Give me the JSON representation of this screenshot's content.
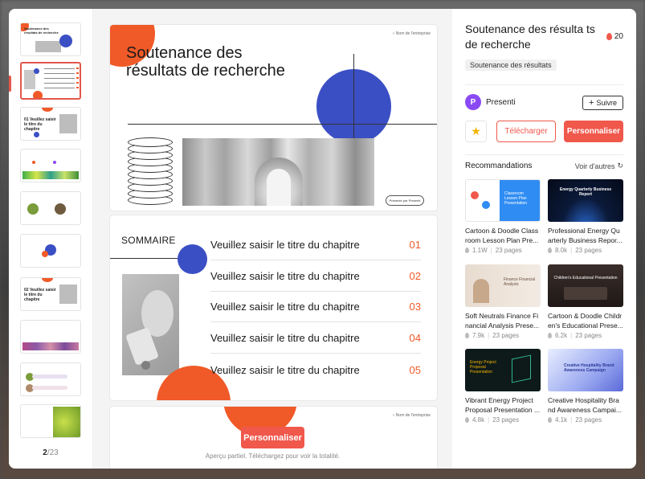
{
  "thumbnails": {
    "pager_current": "2",
    "pager_total": "/23",
    "first_title": "Soutenance des résultats de recherche",
    "third_title": "01 Veuillez saisir le titre du chapitre",
    "seventh_title": "02 Veuillez saisir le titre du chapitre"
  },
  "preview": {
    "company_label": "Nom de l'entreprise",
    "slide1_title_line1": "Soutenance des",
    "slide1_title_line2": "résultats de recherche",
    "presenter_label": "Présenté par Presenti",
    "sommaire": "SOMMAIRE",
    "toc": [
      {
        "text": "Veuillez saisir le titre du chapitre",
        "num": "01"
      },
      {
        "text": "Veuillez saisir le titre du chapitre",
        "num": "02"
      },
      {
        "text": "Veuillez saisir le titre du chapitre",
        "num": "03"
      },
      {
        "text": "Veuillez saisir le titre du chapitre",
        "num": "04"
      },
      {
        "text": "Veuillez saisir le titre du chapitre",
        "num": "05"
      }
    ],
    "cta_label": "Personnaliser",
    "note": "Aperçu partiel. Téléchargez pour voir la totalité."
  },
  "panel": {
    "title": "Soutenance des résulta ts de recherche",
    "likes": "20",
    "tag": "Soutenance des résultats",
    "author_initial": "P",
    "author_name": "Presenti",
    "follow_label": "Suivre",
    "download_label": "Télécharger",
    "personalize_label": "Personnaliser",
    "recommendations_label": "Recommandations",
    "see_more_label": "Voir d'autres",
    "accent": "#f0584c"
  },
  "cards": [
    {
      "title": "Cartoon & Doodle Class room Lesson Plan Pre...",
      "views": "1.1W",
      "pages": "23 pages",
      "img_text": "Classroom Lesson Plan Presentation"
    },
    {
      "title": "Professional Energy Qu arterly Business Repor...",
      "views": "8.0k",
      "pages": "23 pages",
      "img_text": "Energy Quarterly Business Report"
    },
    {
      "title": "Soft Neutrals Finance Fi nancial Analysis Prese...",
      "views": "7.9k",
      "pages": "23 pages",
      "img_text": "Finance Financial Analysis"
    },
    {
      "title": "Cartoon & Doodle Childr en's Educational Prese...",
      "views": "6.2k",
      "pages": "23 pages",
      "img_text": "Children's Educational Presentation"
    },
    {
      "title": "Vibrant Energy Project Proposal Presentation ...",
      "views": "4.8k",
      "pages": "23 pages",
      "img_text": "Energy Project Proposal Presentation"
    },
    {
      "title": "Creative Hospitality Bra nd Awareness Campai...",
      "views": "4.1k",
      "pages": "23 pages",
      "img_text": "Creative Hospitality Brand Awareness Campaign"
    }
  ]
}
